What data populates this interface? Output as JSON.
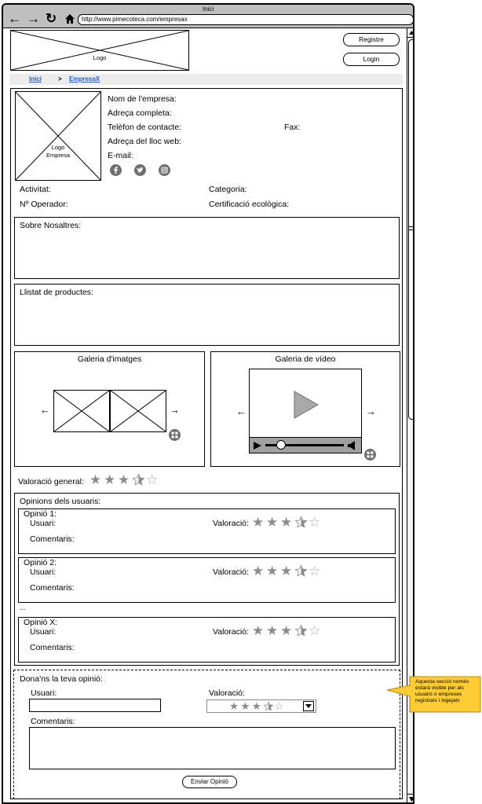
{
  "browser": {
    "window_title": "Inici",
    "url": "http://www.pimecoteca.com/empresax"
  },
  "header": {
    "logo_label": "Logo",
    "register_label": "Registre",
    "login_label": "Login"
  },
  "breadcrumb": {
    "home": "Inici",
    "separator": ">",
    "current": "EmpresaX"
  },
  "company": {
    "logo_label_line1": "Logo",
    "logo_label_line2": "Empresa",
    "name_label": "Nom de l'empresa:",
    "address_label": "Adreça completa:",
    "phone_label": "Telèfon de contacte:",
    "fax_label": "Fax:",
    "web_label": "Adreça del lloc web:",
    "email_label": "E-mail:",
    "social_icons": [
      "facebook-icon",
      "twitter-icon",
      "instagram-icon"
    ],
    "activity_label": "Activitat:",
    "category_label": "Categoria:",
    "operator_label": "Nº Operador:",
    "eco_label": "Certificació ecològica:"
  },
  "about": {
    "label": "Sobre Nosaltres:"
  },
  "products": {
    "label": "Llistat de productes:"
  },
  "gallery_images": {
    "title": "Galeria d'imatges"
  },
  "gallery_video": {
    "title": "Galeria de vídeo",
    "progress": 0.2
  },
  "rating": {
    "label": "Valoració general:",
    "value": 3.5,
    "max": 5
  },
  "opinions": {
    "title": "Opinions dels usuaris:",
    "items": [
      {
        "title": "Opinió 1:",
        "user_label": "Usuari:",
        "rating_label": "Valoració:",
        "comments_label": "Comentaris:",
        "rating": 3.5
      },
      {
        "title": "Opinió 2:",
        "user_label": "Usuari:",
        "rating_label": "Valoració:",
        "comments_label": "Comentaris:",
        "rating": 3.5
      },
      {
        "title": "Opinió X:",
        "user_label": "Usuari:",
        "rating_label": "Valoració:",
        "comments_label": "Comentaris:",
        "rating": 3.5
      }
    ],
    "ellipsis": "..."
  },
  "form": {
    "title": "Dona'ns la teva opinió:",
    "user_label": "Usuari:",
    "user_value": "",
    "rating_label": "Valoració:",
    "rating_value": 3.5,
    "comments_label": "Comentaris:",
    "comments_value": "",
    "submit_label": "Enviar Opinió"
  },
  "callout": {
    "lines": [
      "Aquesta secció només",
      "estarà visible per als",
      "usuaris o empreses",
      "registrats i logejats"
    ],
    "color": "#ffcc33"
  },
  "colors": {
    "link": "#1f5fc8",
    "star": "#8c8c8c",
    "titlebar": "#bfbfbf"
  }
}
